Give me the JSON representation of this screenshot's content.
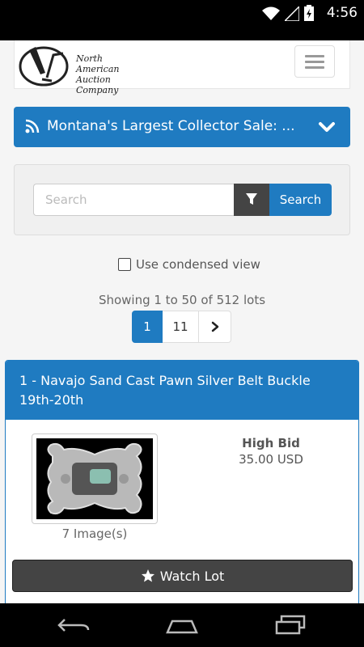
{
  "status": {
    "time": "4:56"
  },
  "header": {
    "logo_line1": "North American",
    "logo_line2": "Auction Company"
  },
  "sale": {
    "title": "Montana's Largest Collector Sale: ..."
  },
  "search": {
    "placeholder": "Search",
    "button_label": "Search"
  },
  "condensed_view": {
    "label": "Use condensed view"
  },
  "results": {
    "showing": "Showing 1 to 50 of 512 lots"
  },
  "pagination": {
    "pages": [
      "1",
      "11"
    ],
    "next": "›"
  },
  "lot": {
    "title": "1 - Navajo Sand Cast Pawn Silver Belt Buckle 19th-20th",
    "images": "7 Image(s)",
    "high_bid_label": "High Bid",
    "high_bid_value": "35.00 USD",
    "watch_label": "Watch Lot"
  },
  "colors": {
    "primary": "#1f7bc1",
    "dark_button": "#444444"
  }
}
